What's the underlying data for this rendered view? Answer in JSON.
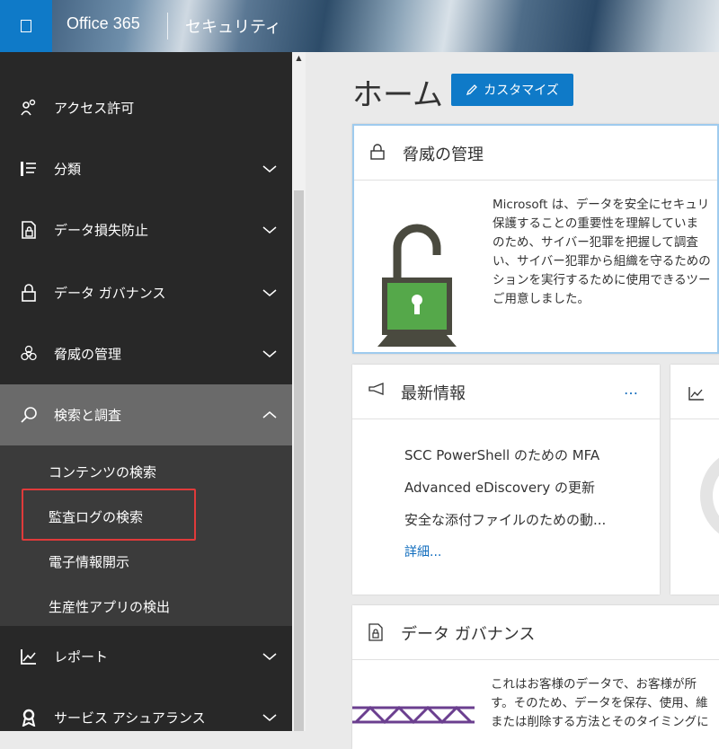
{
  "header": {
    "brand": "Office 365",
    "section": "セキュリティ"
  },
  "sidebar": {
    "items": [
      {
        "label": "アクセス許可",
        "icon": "permissions-icon"
      },
      {
        "label": "分類",
        "icon": "classification-icon"
      },
      {
        "label": "データ損失防止",
        "icon": "data-loss-prevention-icon"
      },
      {
        "label": "データ ガバナンス",
        "icon": "lock-icon"
      },
      {
        "label": "脅威の管理",
        "icon": "biohazard-icon"
      },
      {
        "label": "検索と調査",
        "icon": "search-icon"
      },
      {
        "label": "レポート",
        "icon": "chart-icon"
      },
      {
        "label": "サービス アシュアランス",
        "icon": "ribbon-icon"
      }
    ],
    "subitems": [
      "コンテンツの検索",
      "監査ログの検索",
      "電子情報開示",
      "生産性アプリの検出"
    ]
  },
  "main": {
    "title": "ホーム",
    "customize_label": "カスタマイズ",
    "threat_card": {
      "title": "脅威の管理",
      "lines": [
        "Microsoft は、データを安全にセキュリ",
        "保護することの重要性を理解していま",
        "のため、サイバー犯罪を把握して調査",
        "い、サイバー犯罪から組織を守るための",
        "ションを実行するために使用できるツー",
        "ご用意しました。"
      ]
    },
    "news_card": {
      "title": "最新情報",
      "more_icon": "…",
      "items": [
        "SCC PowerShell のための MFA",
        "Advanced eDiscovery の更新",
        "安全な添付ファイルのための動..."
      ],
      "more": "詳細..."
    },
    "gov_card": {
      "title": "データ ガバナンス",
      "lines": [
        "これはお客様のデータで、お客様が所",
        "す。そのため、データを保存、使用、維",
        "または削除する方法とそのタイミングに"
      ]
    }
  }
}
